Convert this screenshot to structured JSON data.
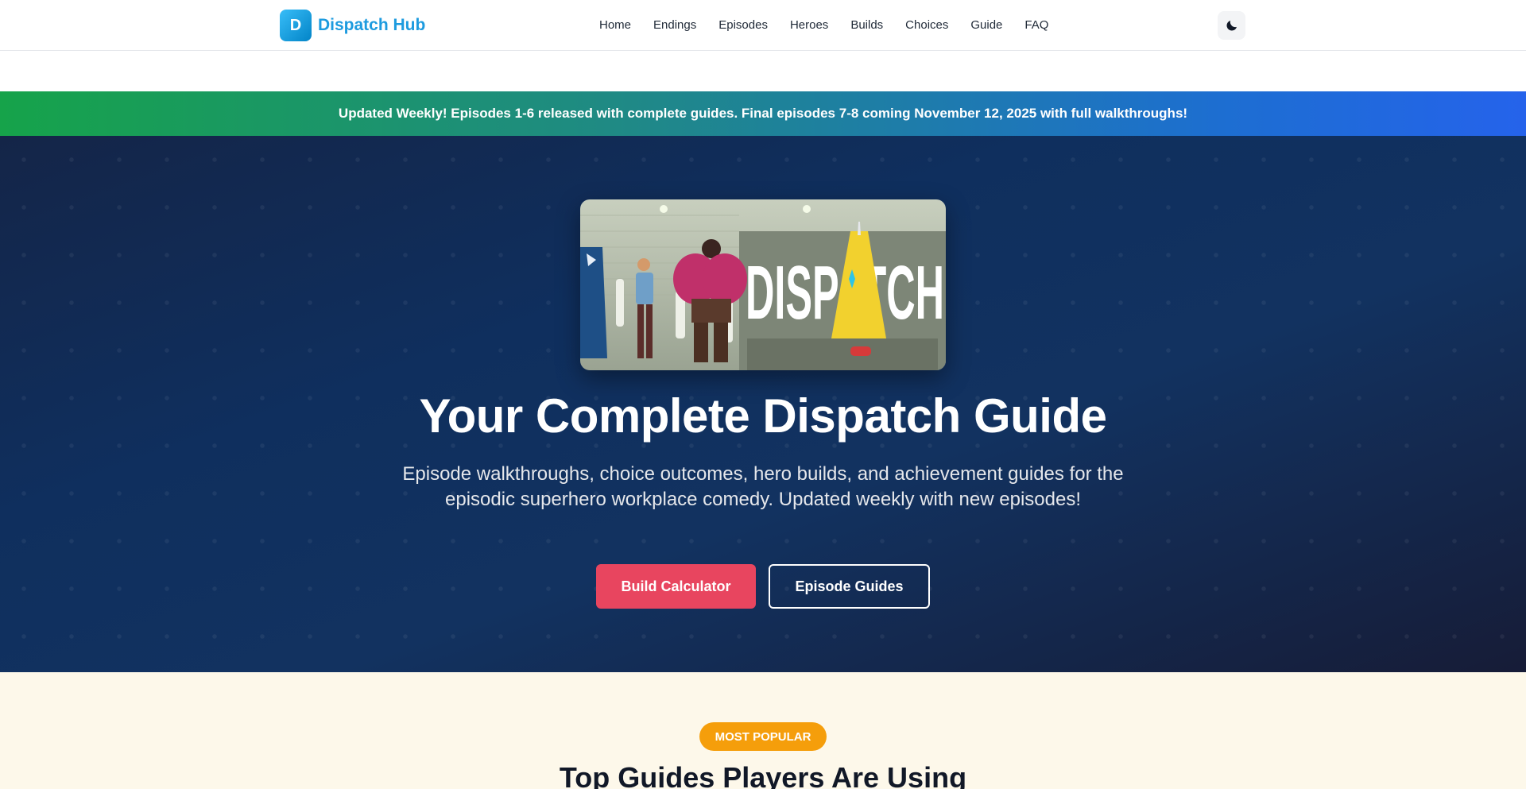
{
  "nav": {
    "brand_letter": "D",
    "brand_name": "Dispatch Hub",
    "links": [
      "Home",
      "Endings",
      "Episodes",
      "Heroes",
      "Builds",
      "Choices",
      "Guide",
      "FAQ"
    ],
    "theme_toggle_icon": "moon-icon"
  },
  "banner": {
    "text": "Updated Weekly! Episodes 1-6 released with complete guides. Final episodes 7-8 coming November 12, 2025 with full walkthroughs!"
  },
  "hero": {
    "image_logo_text": "DISPATCH",
    "title": "Your Complete Dispatch Guide",
    "subtitle": "Episode walkthroughs, choice outcomes, hero builds, and achievement guides for the episodic superhero workplace comedy. Updated weekly with new episodes!",
    "primary_button": "Build Calculator",
    "secondary_button": "Episode Guides"
  },
  "popular": {
    "badge": "MOST POPULAR",
    "title": "Top Guides Players Are Using"
  },
  "colors": {
    "brand": "#1d9bdf",
    "primary_button": "#e8455f",
    "badge": "#f59e0b",
    "hero_bg": "#0f2f5e",
    "banner_start": "#16a34a",
    "banner_end": "#2563eb"
  }
}
